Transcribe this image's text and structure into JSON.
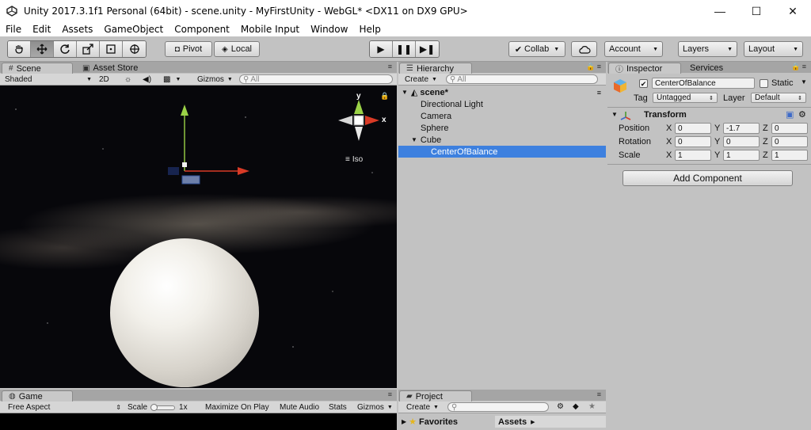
{
  "window": {
    "title": "Unity 2017.3.1f1 Personal (64bit) - scene.unity - MyFirstUnity - WebGL* <DX11 on DX9 GPU>",
    "minimize": "—",
    "maximize": "☐",
    "close": "✕"
  },
  "menu": [
    "File",
    "Edit",
    "Assets",
    "GameObject",
    "Component",
    "Mobile Input",
    "Window",
    "Help"
  ],
  "toolbar": {
    "tools": [
      "hand-icon",
      "move-icon",
      "rotate-icon",
      "scale-icon",
      "rect-icon",
      "transform-icon"
    ],
    "pivot": "Pivot",
    "local": "Local",
    "collab": "Collab",
    "account": "Account",
    "layers": "Layers",
    "layout": "Layout"
  },
  "scene": {
    "tabs": {
      "scene": "Scene",
      "asset_store": "Asset Store"
    },
    "shading": "Shaded",
    "mode_2d": "2D",
    "gizmos": "Gizmos",
    "search_placeholder": "All",
    "iso_label": "Iso",
    "axis_y": "y",
    "axis_x": "x"
  },
  "game": {
    "tab": "Game",
    "aspect": "Free Aspect",
    "scale_label": "Scale",
    "scale_value": "1x",
    "maximize": "Maximize On Play",
    "mute": "Mute Audio",
    "stats": "Stats",
    "gizmos": "Gizmos"
  },
  "hierarchy": {
    "tab": "Hierarchy",
    "create": "Create",
    "search_placeholder": "All",
    "scene_name": "scene*",
    "items": [
      {
        "label": "Directional Light"
      },
      {
        "label": "Camera"
      },
      {
        "label": "Sphere"
      },
      {
        "label": "Cube"
      },
      {
        "label": "CenterOfBalance"
      }
    ]
  },
  "project": {
    "tab": "Project",
    "create": "Create",
    "favorites": "Favorites",
    "assets": "Assets"
  },
  "inspector": {
    "tabs": {
      "inspector": "Inspector",
      "services": "Services"
    },
    "object_name": "CenterOfBalance",
    "static_label": "Static",
    "tag_label": "Tag",
    "tag_value": "Untagged",
    "layer_label": "Layer",
    "layer_value": "Default",
    "transform_title": "Transform",
    "rows": [
      {
        "label": "Position",
        "x": "0",
        "y": "-1.7",
        "z": "0"
      },
      {
        "label": "Rotation",
        "x": "0",
        "y": "0",
        "z": "0"
      },
      {
        "label": "Scale",
        "x": "1",
        "y": "1",
        "z": "1"
      }
    ],
    "axis_labels": {
      "x": "X",
      "y": "Y",
      "z": "Z"
    },
    "add_component": "Add Component"
  }
}
